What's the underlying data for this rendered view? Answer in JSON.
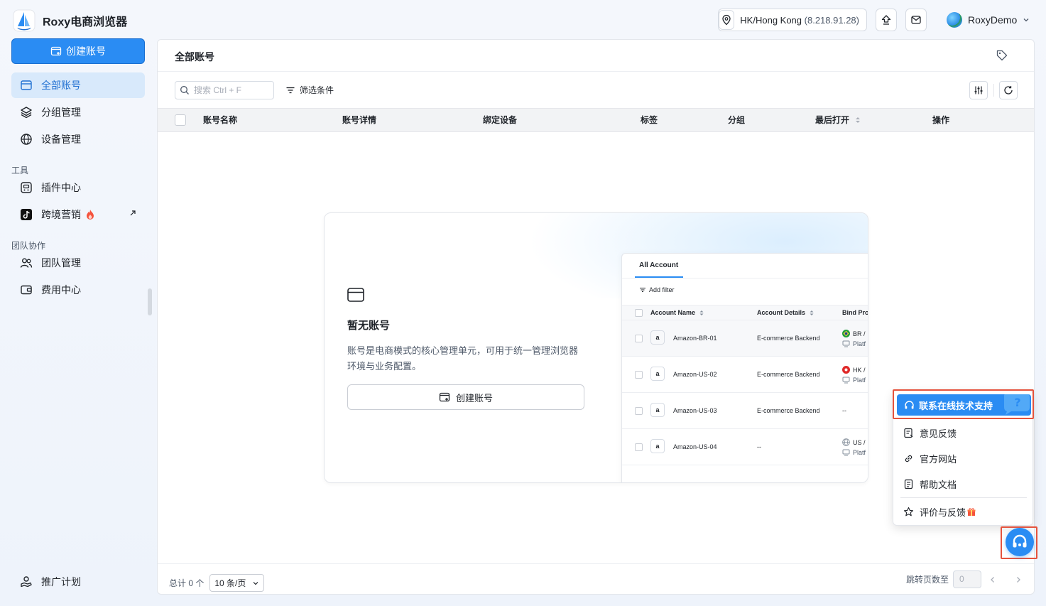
{
  "app": {
    "name": "Roxy电商浏览器"
  },
  "sidebar": {
    "create_label": "创建账号",
    "items": [
      {
        "label": "全部账号",
        "icon": "card-icon",
        "active": true
      },
      {
        "label": "分组管理",
        "icon": "layers-icon"
      },
      {
        "label": "设备管理",
        "icon": "globe-icon"
      }
    ],
    "tools_label": "工具",
    "tools": [
      {
        "label": "插件中心",
        "icon": "plugin-icon"
      },
      {
        "label": "跨境营销",
        "icon": "tiktok-icon"
      }
    ],
    "team_label": "团队协作",
    "team": [
      {
        "label": "团队管理",
        "icon": "team-icon"
      },
      {
        "label": "费用中心",
        "icon": "wallet-icon"
      }
    ],
    "promo": {
      "label": "推广计划",
      "icon": "promo-icon"
    }
  },
  "topbar": {
    "location": "HK/Hong Kong",
    "ip": "(8.218.91.28)",
    "user": "RoxyDemo"
  },
  "main": {
    "title": "全部账号",
    "search_placeholder": "搜索 Ctrl + F",
    "filter_label": "筛选条件",
    "columns": [
      "账号名称",
      "账号详情",
      "绑定设备",
      "标签",
      "分组",
      "最后打开",
      "操作"
    ],
    "empty": {
      "title": "暂无账号",
      "desc": "账号是电商模式的核心管理单元，可用于统一管理浏览器环境与业务配置。",
      "button": "创建账号"
    },
    "preview": {
      "tab": "All Account",
      "filter": "Add filter",
      "headers": [
        "Account Name",
        "Account Details",
        "Bind Pro"
      ],
      "rows": [
        {
          "name": "Amazon-BR-01",
          "details": "E-commerce Backend",
          "bind": "BR /",
          "bind2": "Platf",
          "flag": "flag-br-icon"
        },
        {
          "name": "Amazon-US-02",
          "details": "E-commerce Backend",
          "bind": "HK /",
          "bind2": "Platf",
          "flag": "flag-hk-icon"
        },
        {
          "name": "Amazon-US-03",
          "details": "E-commerce Backend",
          "bind": "--",
          "bind2": "",
          "flag": ""
        },
        {
          "name": "Amazon-US-04",
          "details": "--",
          "bind": "US /",
          "bind2": "Platf",
          "flag": "flag-us-icon"
        }
      ]
    },
    "footer": {
      "total": "总计 0 个",
      "page_size": "10 条/页",
      "jump_label": "跳转页数至",
      "jump_value": "0"
    }
  },
  "help_menu": {
    "primary": "联系在线技术支持",
    "items": [
      "意见反馈",
      "官方网站",
      "帮助文档",
      "评价与反馈"
    ]
  },
  "colors": {
    "accent": "#2a8cf3",
    "highlight": "#e5533d"
  }
}
